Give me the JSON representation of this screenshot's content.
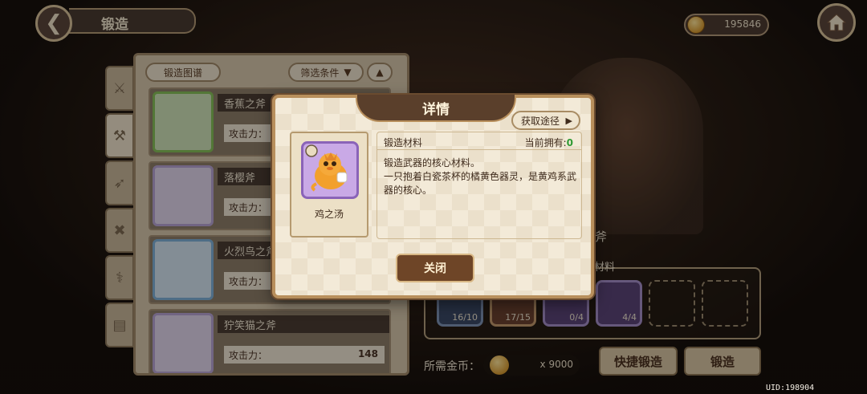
{
  "header": {
    "title": "锻造",
    "coins": "195846"
  },
  "list": {
    "tab_label": "锻造图谱",
    "filter_label": "筛选条件",
    "weapons": [
      {
        "name": "香蕉之斧",
        "atk_label": "攻击力：",
        "atk": ""
      },
      {
        "name": "落樱斧",
        "atk_label": "攻击力：",
        "atk": ""
      },
      {
        "name": "火烈鸟之斧",
        "atk_label": "攻击力：",
        "atk": ""
      },
      {
        "name": "狞笑猫之斧",
        "atk_label": "攻击力：",
        "atk": "148"
      }
    ]
  },
  "forge": {
    "weapon_title": "之斧",
    "materials_label": "材料",
    "slots": [
      {
        "count": "16/10"
      },
      {
        "count": "17/15"
      },
      {
        "count": "0/4"
      },
      {
        "count": "4/4"
      }
    ],
    "cost_label": "所需金币：",
    "cost_amount": "x 9000",
    "quick_forge": "快捷锻造",
    "forge": "锻造"
  },
  "dialog": {
    "title": "详情",
    "source_button": "获取途径",
    "item_name": "鸡之汤",
    "section_label": "锻造材料",
    "owned_label": "当前拥有:",
    "owned_count": "0",
    "description": "锻造武器的核心材料。\n一只抱着白瓷茶杯的橘黄色器灵，是黄鸡系武器的核心。",
    "close": "关闭"
  },
  "uid": "UID:198904",
  "colors": {
    "accent_dark": "#5a3f2b",
    "dialog_bg": "#f3ead8",
    "owned_green": "#2f9a33"
  }
}
